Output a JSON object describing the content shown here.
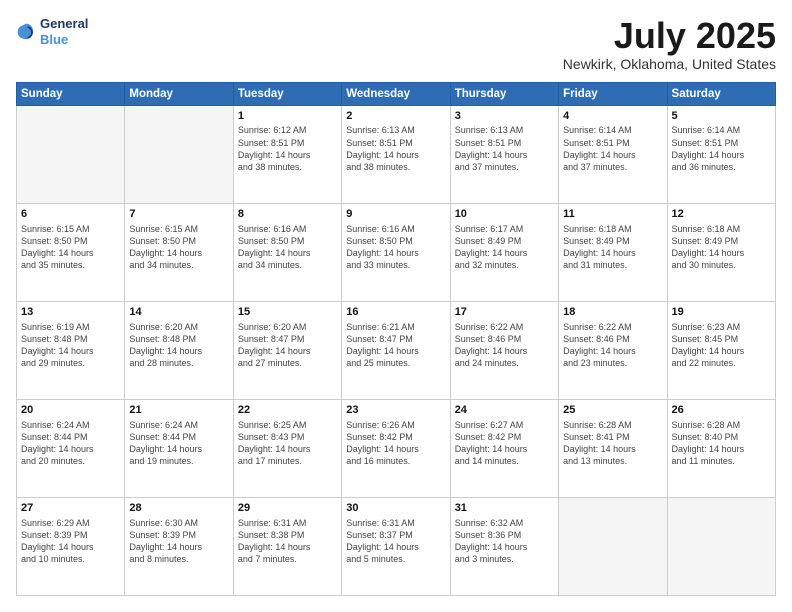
{
  "header": {
    "logo_line1": "General",
    "logo_line2": "Blue",
    "month_year": "July 2025",
    "location": "Newkirk, Oklahoma, United States"
  },
  "weekdays": [
    "Sunday",
    "Monday",
    "Tuesday",
    "Wednesday",
    "Thursday",
    "Friday",
    "Saturday"
  ],
  "weeks": [
    [
      {
        "day": "",
        "info": ""
      },
      {
        "day": "",
        "info": ""
      },
      {
        "day": "1",
        "info": "Sunrise: 6:12 AM\nSunset: 8:51 PM\nDaylight: 14 hours\nand 38 minutes."
      },
      {
        "day": "2",
        "info": "Sunrise: 6:13 AM\nSunset: 8:51 PM\nDaylight: 14 hours\nand 38 minutes."
      },
      {
        "day": "3",
        "info": "Sunrise: 6:13 AM\nSunset: 8:51 PM\nDaylight: 14 hours\nand 37 minutes."
      },
      {
        "day": "4",
        "info": "Sunrise: 6:14 AM\nSunset: 8:51 PM\nDaylight: 14 hours\nand 37 minutes."
      },
      {
        "day": "5",
        "info": "Sunrise: 6:14 AM\nSunset: 8:51 PM\nDaylight: 14 hours\nand 36 minutes."
      }
    ],
    [
      {
        "day": "6",
        "info": "Sunrise: 6:15 AM\nSunset: 8:50 PM\nDaylight: 14 hours\nand 35 minutes."
      },
      {
        "day": "7",
        "info": "Sunrise: 6:15 AM\nSunset: 8:50 PM\nDaylight: 14 hours\nand 34 minutes."
      },
      {
        "day": "8",
        "info": "Sunrise: 6:16 AM\nSunset: 8:50 PM\nDaylight: 14 hours\nand 34 minutes."
      },
      {
        "day": "9",
        "info": "Sunrise: 6:16 AM\nSunset: 8:50 PM\nDaylight: 14 hours\nand 33 minutes."
      },
      {
        "day": "10",
        "info": "Sunrise: 6:17 AM\nSunset: 8:49 PM\nDaylight: 14 hours\nand 32 minutes."
      },
      {
        "day": "11",
        "info": "Sunrise: 6:18 AM\nSunset: 8:49 PM\nDaylight: 14 hours\nand 31 minutes."
      },
      {
        "day": "12",
        "info": "Sunrise: 6:18 AM\nSunset: 8:49 PM\nDaylight: 14 hours\nand 30 minutes."
      }
    ],
    [
      {
        "day": "13",
        "info": "Sunrise: 6:19 AM\nSunset: 8:48 PM\nDaylight: 14 hours\nand 29 minutes."
      },
      {
        "day": "14",
        "info": "Sunrise: 6:20 AM\nSunset: 8:48 PM\nDaylight: 14 hours\nand 28 minutes."
      },
      {
        "day": "15",
        "info": "Sunrise: 6:20 AM\nSunset: 8:47 PM\nDaylight: 14 hours\nand 27 minutes."
      },
      {
        "day": "16",
        "info": "Sunrise: 6:21 AM\nSunset: 8:47 PM\nDaylight: 14 hours\nand 25 minutes."
      },
      {
        "day": "17",
        "info": "Sunrise: 6:22 AM\nSunset: 8:46 PM\nDaylight: 14 hours\nand 24 minutes."
      },
      {
        "day": "18",
        "info": "Sunrise: 6:22 AM\nSunset: 8:46 PM\nDaylight: 14 hours\nand 23 minutes."
      },
      {
        "day": "19",
        "info": "Sunrise: 6:23 AM\nSunset: 8:45 PM\nDaylight: 14 hours\nand 22 minutes."
      }
    ],
    [
      {
        "day": "20",
        "info": "Sunrise: 6:24 AM\nSunset: 8:44 PM\nDaylight: 14 hours\nand 20 minutes."
      },
      {
        "day": "21",
        "info": "Sunrise: 6:24 AM\nSunset: 8:44 PM\nDaylight: 14 hours\nand 19 minutes."
      },
      {
        "day": "22",
        "info": "Sunrise: 6:25 AM\nSunset: 8:43 PM\nDaylight: 14 hours\nand 17 minutes."
      },
      {
        "day": "23",
        "info": "Sunrise: 6:26 AM\nSunset: 8:42 PM\nDaylight: 14 hours\nand 16 minutes."
      },
      {
        "day": "24",
        "info": "Sunrise: 6:27 AM\nSunset: 8:42 PM\nDaylight: 14 hours\nand 14 minutes."
      },
      {
        "day": "25",
        "info": "Sunrise: 6:28 AM\nSunset: 8:41 PM\nDaylight: 14 hours\nand 13 minutes."
      },
      {
        "day": "26",
        "info": "Sunrise: 6:28 AM\nSunset: 8:40 PM\nDaylight: 14 hours\nand 11 minutes."
      }
    ],
    [
      {
        "day": "27",
        "info": "Sunrise: 6:29 AM\nSunset: 8:39 PM\nDaylight: 14 hours\nand 10 minutes."
      },
      {
        "day": "28",
        "info": "Sunrise: 6:30 AM\nSunset: 8:39 PM\nDaylight: 14 hours\nand 8 minutes."
      },
      {
        "day": "29",
        "info": "Sunrise: 6:31 AM\nSunset: 8:38 PM\nDaylight: 14 hours\nand 7 minutes."
      },
      {
        "day": "30",
        "info": "Sunrise: 6:31 AM\nSunset: 8:37 PM\nDaylight: 14 hours\nand 5 minutes."
      },
      {
        "day": "31",
        "info": "Sunrise: 6:32 AM\nSunset: 8:36 PM\nDaylight: 14 hours\nand 3 minutes."
      },
      {
        "day": "",
        "info": ""
      },
      {
        "day": "",
        "info": ""
      }
    ]
  ]
}
